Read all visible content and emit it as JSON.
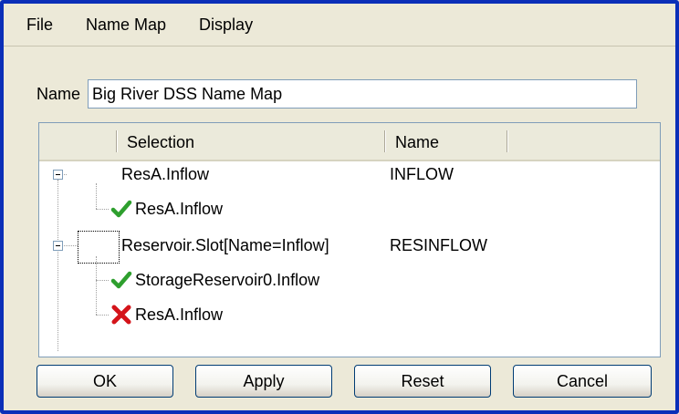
{
  "menu": {
    "items": [
      {
        "label": "File"
      },
      {
        "label": "Name Map"
      },
      {
        "label": "Display"
      }
    ]
  },
  "name_field": {
    "label": "Name",
    "value": "Big River DSS Name Map"
  },
  "tree": {
    "columns": [
      "Selection",
      "Name"
    ],
    "rows": [
      {
        "selection": "ResA.Inflow",
        "name": "INFLOW",
        "expanded": true
      },
      {
        "selection": "ResA.Inflow",
        "status": "check-icon"
      },
      {
        "selection": "Reservoir.Slot[Name=Inflow]",
        "name": "RESINFLOW",
        "expanded": true
      },
      {
        "selection": "StorageReservoir0.Inflow",
        "status": "check-icon"
      },
      {
        "selection": "ResA.Inflow",
        "status": "x-icon"
      }
    ]
  },
  "buttons": {
    "ok": "OK",
    "apply": "Apply",
    "reset": "Reset",
    "cancel": "Cancel"
  },
  "colors": {
    "window_border": "#0b2fb8",
    "background": "#ece9d8",
    "check": "#2e9f2e",
    "x": "#d4141a"
  }
}
